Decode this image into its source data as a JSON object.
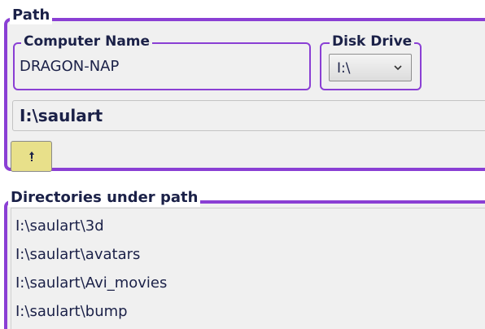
{
  "path_group": {
    "legend": "Path",
    "computer_name": {
      "legend": "Computer Name",
      "value": "DRAGON-NAP"
    },
    "disk_drive": {
      "legend": "Disk Drive",
      "selected": "I:\\"
    },
    "current_path": "I:\\saulart",
    "up_button_icon": "up-arrow-icon"
  },
  "directories": {
    "legend": "Directories under path",
    "items": [
      "I:\\saulart\\3d",
      "I:\\saulart\\avatars",
      "I:\\saulart\\Avi_movies",
      "I:\\saulart\\bump"
    ]
  },
  "colors": {
    "accent": "#8a3fd4",
    "text": "#1b2148",
    "panel_background": "#f0f0f0",
    "up_button": "#e8e08a"
  }
}
